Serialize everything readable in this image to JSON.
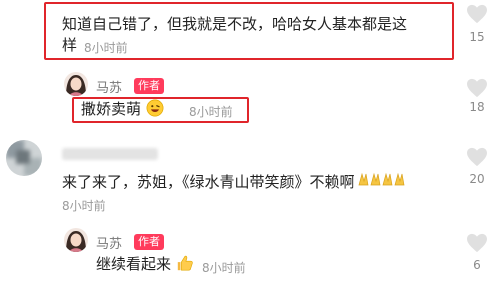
{
  "comments": [
    {
      "text_line1": "知道自己错了，但我就是不改，哈哈女人基本都是这",
      "text_line2": "样",
      "time": "8小时前",
      "likes": "15"
    },
    {
      "text": "来了来了，苏姐，《绿水青山带笑颜》不赖啊",
      "time": "8小时前",
      "likes": "20"
    }
  ],
  "replies": [
    {
      "author": "马苏",
      "badge": "作者",
      "text": "撒娇卖萌",
      "emoji": "grinning-face",
      "time": "8小时前",
      "likes": "18"
    },
    {
      "author": "马苏",
      "badge": "作者",
      "text": "继续看起来",
      "emoji": "thumbs-up",
      "time": "8小时前",
      "likes": "6"
    }
  ],
  "icons": {
    "like": "heart-icon"
  },
  "colors": {
    "accent": "#ff3b5c",
    "highlight": "#e0252b"
  }
}
